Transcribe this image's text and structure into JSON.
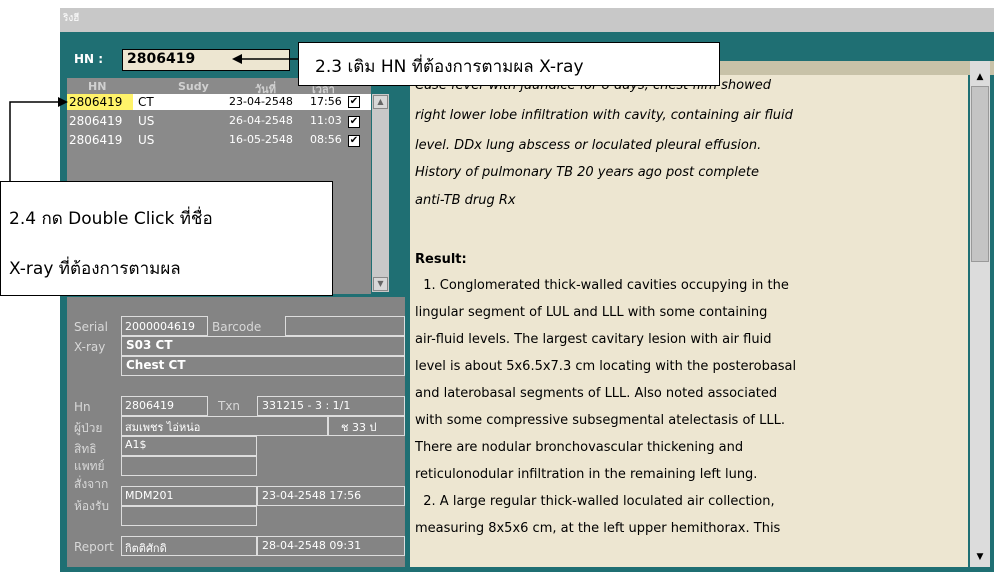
{
  "window": {
    "title": "ริงฮี"
  },
  "search": {
    "label": "HN :",
    "value": "2806419"
  },
  "list": {
    "headers": [
      "HN",
      "Sudy",
      "วันที่",
      "เวลา"
    ],
    "rows": [
      {
        "hn": "2806419",
        "study": "CT",
        "date": "23-04-2548",
        "time": "17:56",
        "checked": "✔"
      },
      {
        "hn": "2806419",
        "study": "US",
        "date": "26-04-2548",
        "time": "11:03",
        "checked": "✔"
      },
      {
        "hn": "2806419",
        "study": "US",
        "date": "16-05-2548",
        "time": "08:56",
        "checked": "✔"
      }
    ]
  },
  "detail": {
    "serial_label": "Serial",
    "serial": "2000004619",
    "barcode_label": "Barcode",
    "xray_label": "X-ray",
    "xray": "S03 CT",
    "exam": "Chest CT",
    "hn_label": "Hn",
    "hn": "2806419",
    "txn_label": "Txn",
    "txn": "331215 - 3 : 1/1",
    "patient_label": "ผู้ป่วย",
    "patient": "สมเพชร ไอ่หน่อ",
    "patient_age": "ช 33 ป",
    "right_label": "สิทธิ",
    "right": "A1$",
    "doctor_label": "แพทย์",
    "from_label": "สั่งจาก",
    "from": "MDM201",
    "from_date": "23-04-2548  17:56",
    "room_label": "ห้องรับ",
    "report_label": "Report",
    "report_by": "กิตติศักดิ",
    "report_date": "28-04-2548  09:31"
  },
  "report": {
    "lines": [
      "Case fever with jaundice for 8 days, chest film showed",
      "right lower lobe infiltration with cavity, containing air fluid",
      "level. DDx lung abscess or loculated pleural effusion.",
      "History of pulmonary TB 20 years ago post complete",
      "anti-TB drug Rx"
    ],
    "result_label": "Result:",
    "result_lines": [
      "  1. Conglomerated thick-walled cavities occupying in the",
      "lingular segment of LUL and LLL with some containing",
      "air-fluid levels. The largest cavitary lesion with air fluid",
      "level is about 5x6.5x7.3 cm locating with the posterobasal",
      "and laterobasal segments of LLL. Also noted associated",
      "with some compressive subsegmental atelectasis of LLL.",
      "There are nodular  bronchovascular thickening and",
      "reticulonodular infiltration in the remaining left lung.",
      "  2. A large regular thick-walled loculated air collection,",
      "measuring 8x5x6 cm, at the left upper hemithorax. This"
    ]
  },
  "callouts": {
    "step_2_3": "2.3 เติม HN ที่ต้องการตามผล X-ray",
    "step_2_4_line1": "2.4 กด Double Click ที่ชื่อ",
    "step_2_4_line2": "X-ray ที่ต้องการตามผล"
  }
}
